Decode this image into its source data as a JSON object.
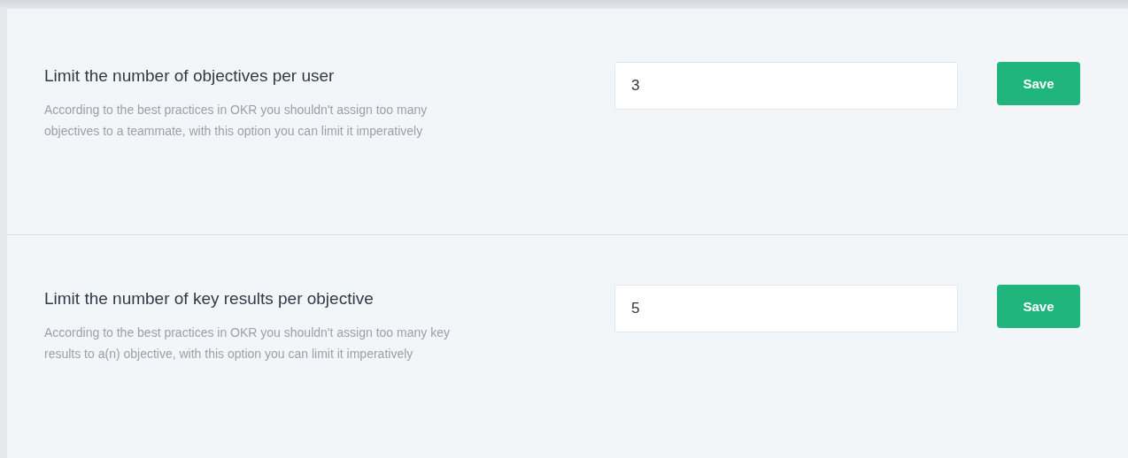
{
  "settings": [
    {
      "title": "Limit the number of objectives per user",
      "description": "According to the best practices in OKR you shouldn't assign too many objectives to a teammate, with this option you can limit it imperatively",
      "value": "3",
      "button": "Save"
    },
    {
      "title": "Limit the number of key results per objective",
      "description": "According to the best practices in OKR you shouldn't assign too many key results to a(n) objective, with this option you can limit it imperatively",
      "value": "5",
      "button": "Save"
    }
  ]
}
